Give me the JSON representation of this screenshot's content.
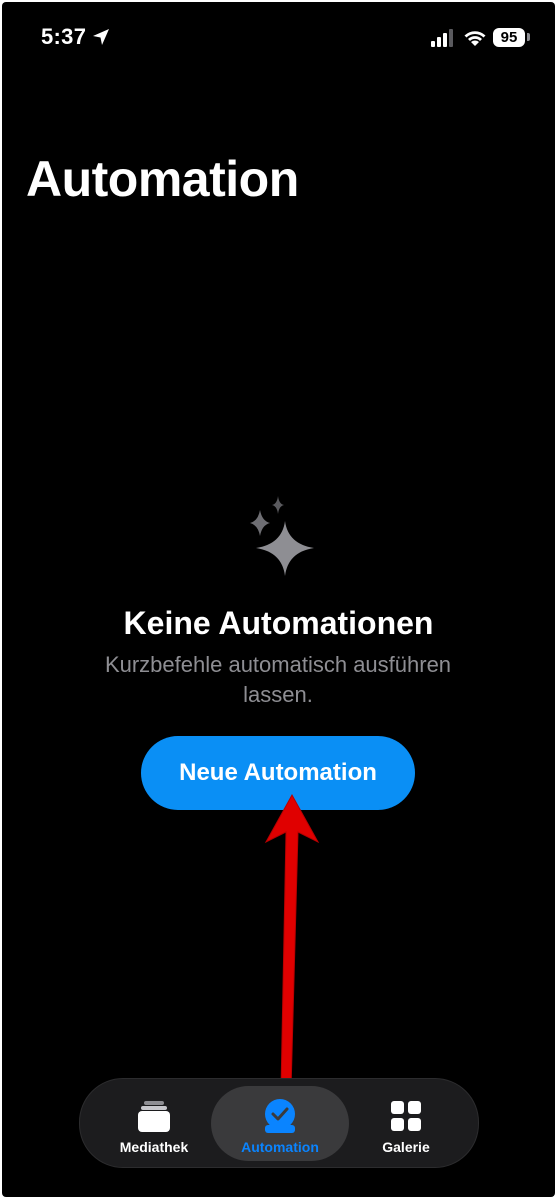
{
  "status_bar": {
    "time": "5:37",
    "battery": "95",
    "icons": [
      "location-arrow-icon",
      "cellular-signal-icon",
      "wifi-icon",
      "battery-icon"
    ]
  },
  "page": {
    "title": "Automation"
  },
  "empty_state": {
    "icon": "sparkles-icon",
    "title": "Keine Automationen",
    "description": "Kurzbefehle automatisch ausführen lassen."
  },
  "primary_action": {
    "label": "Neue Automation"
  },
  "annotation": {
    "type": "arrow",
    "color": "#e00000",
    "points_to": "new-automation-button"
  },
  "tab_bar": {
    "selected": "Automation",
    "tabs": [
      {
        "label": "Mediathek",
        "icon": "library-stack-icon"
      },
      {
        "label": "Automation",
        "icon": "clock-checkmark-icon"
      },
      {
        "label": "Galerie",
        "icon": "grid-icon"
      }
    ]
  },
  "colors": {
    "background": "#000000",
    "accent": "#0a84ff",
    "button_fill": "#0a8ff5",
    "secondary_text": "#8e8e93",
    "tab_bar_bg": "#1c1c1e"
  }
}
